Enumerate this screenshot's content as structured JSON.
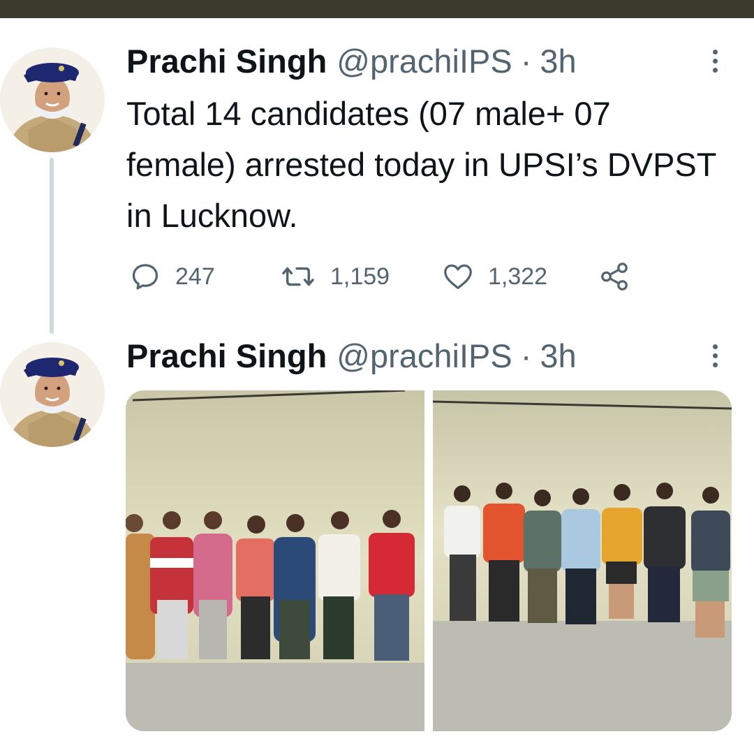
{
  "status_bar": {
    "color": "#3b3a2c"
  },
  "tweets": [
    {
      "author": {
        "name": "Prachi Singh",
        "handle": "@prachiIPS"
      },
      "time": "3h",
      "separator": "·",
      "text": "Total 14 candidates (07 male+ 07 female) arrested today in UPSI’s DVPST in Lucknow.",
      "metrics": {
        "replies": "247",
        "retweets": "1,159",
        "likes": "1,322"
      },
      "icons": {
        "reply": "reply-icon",
        "retweet": "retweet-icon",
        "like": "heart-icon",
        "share": "share-icon",
        "more": "more-options-icon"
      }
    },
    {
      "author": {
        "name": "Prachi Singh",
        "handle": "@prachiIPS"
      },
      "time": "3h",
      "separator": "·",
      "media": [
        {
          "description": "group-photo-female-candidates",
          "people_count": 7
        },
        {
          "description": "group-photo-male-candidates",
          "people_count": 7
        }
      ],
      "icons": {
        "more": "more-options-icon"
      }
    }
  ],
  "colors": {
    "text": "#0f1419",
    "secondary": "#536471",
    "thread_line": "#cfd9de",
    "background": "#ffffff"
  }
}
